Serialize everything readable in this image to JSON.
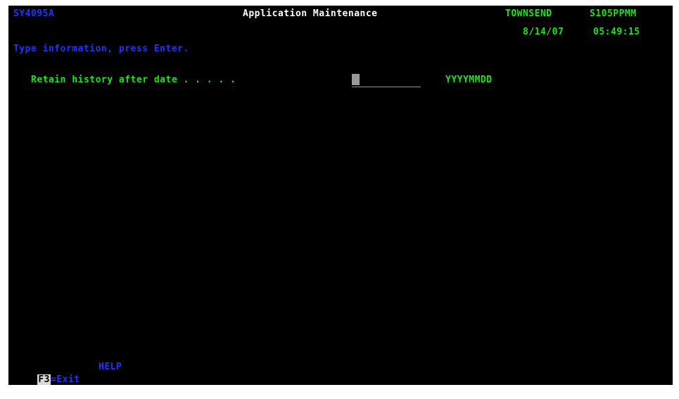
{
  "header": {
    "program_id": "SY4095A",
    "title": "Application Maintenance",
    "user": "TOWNSEND",
    "system": "S105PPMM",
    "date": "8/14/07",
    "time": "05:49:15"
  },
  "instruction": "Type information, press Enter.",
  "form": {
    "retain_label": "Retain history after date . . . . .",
    "retain_value": "",
    "retain_format": "YYYYMMDD"
  },
  "function_keys": {
    "f3_key": "F3",
    "f3_desc": "=Exit",
    "help": "HELP"
  },
  "colors": {
    "background": "#000000",
    "green": "#19e619",
    "blue": "#1f33ff",
    "white": "#ffffff"
  }
}
